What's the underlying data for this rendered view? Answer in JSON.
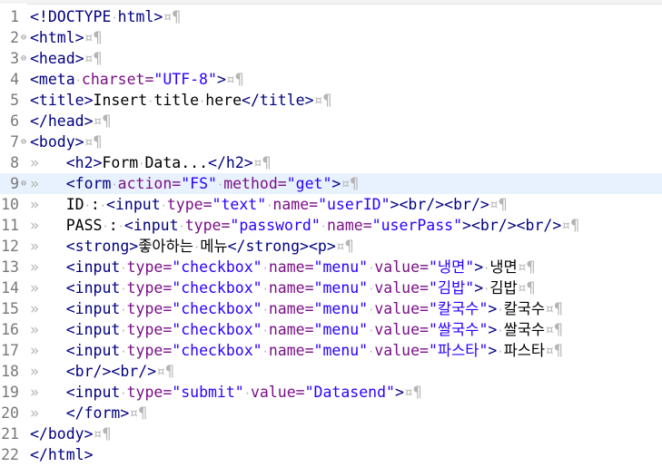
{
  "editor": {
    "lines": [
      {
        "n": "1",
        "fold": false,
        "indent": 0,
        "tokens": [
          [
            "tag",
            "<!DOCTYPE"
          ],
          [
            "ws",
            "·"
          ],
          [
            "tag",
            "html>"
          ]
        ]
      },
      {
        "n": "2",
        "fold": true,
        "indent": 0,
        "tokens": [
          [
            "tag",
            "<html>"
          ]
        ]
      },
      {
        "n": "3",
        "fold": true,
        "indent": 0,
        "tokens": [
          [
            "tag",
            "<head>"
          ]
        ]
      },
      {
        "n": "4",
        "fold": false,
        "indent": 0,
        "tokens": [
          [
            "tag",
            "<meta"
          ],
          [
            "ws",
            "·"
          ],
          [
            "attr",
            "charset="
          ],
          [
            "val",
            "\"UTF-8\""
          ],
          [
            "tag",
            ">"
          ]
        ]
      },
      {
        "n": "5",
        "fold": false,
        "indent": 0,
        "tokens": [
          [
            "tag",
            "<title>"
          ],
          [
            "txt",
            "Insert"
          ],
          [
            "ws",
            "·"
          ],
          [
            "txt",
            "title"
          ],
          [
            "ws",
            "·"
          ],
          [
            "txt",
            "here"
          ],
          [
            "tag",
            "</title>"
          ]
        ]
      },
      {
        "n": "6",
        "fold": false,
        "indent": 0,
        "tokens": [
          [
            "tag",
            "</head>"
          ]
        ]
      },
      {
        "n": "7",
        "fold": true,
        "indent": 0,
        "tokens": [
          [
            "tag",
            "<body>"
          ]
        ]
      },
      {
        "n": "8",
        "fold": false,
        "indent": 1,
        "tokens": [
          [
            "tag",
            "<h2>"
          ],
          [
            "txt",
            "Form"
          ],
          [
            "ws",
            "·"
          ],
          [
            "txt",
            "Data..."
          ],
          [
            "tag",
            "</h2>"
          ]
        ]
      },
      {
        "n": "9",
        "fold": true,
        "indent": 1,
        "current": true,
        "tokens": [
          [
            "tag",
            "<form"
          ],
          [
            "ws",
            "·"
          ],
          [
            "attr",
            "action="
          ],
          [
            "val",
            "\"FS\""
          ],
          [
            "ws",
            "·"
          ],
          [
            "attr",
            "method="
          ],
          [
            "val",
            "\"get\""
          ],
          [
            "tag",
            ">"
          ]
        ]
      },
      {
        "n": "10",
        "fold": false,
        "indent": 1,
        "tokens": [
          [
            "txt",
            "ID"
          ],
          [
            "ws",
            "·"
          ],
          [
            "txt",
            ":"
          ],
          [
            "ws",
            "·"
          ],
          [
            "tag",
            "<input"
          ],
          [
            "ws",
            "·"
          ],
          [
            "attr",
            "type="
          ],
          [
            "val",
            "\"text\""
          ],
          [
            "ws",
            "·"
          ],
          [
            "attr",
            "name="
          ],
          [
            "val",
            "\"userID\""
          ],
          [
            "tag",
            ">"
          ],
          [
            "tag",
            "<br/>"
          ],
          [
            "tag",
            "<br/>"
          ]
        ]
      },
      {
        "n": "11",
        "fold": false,
        "indent": 1,
        "tokens": [
          [
            "txt",
            "PASS"
          ],
          [
            "ws",
            "·"
          ],
          [
            "txt",
            ":"
          ],
          [
            "ws",
            "·"
          ],
          [
            "tag",
            "<input"
          ],
          [
            "ws",
            "·"
          ],
          [
            "attr",
            "type="
          ],
          [
            "val",
            "\"password\""
          ],
          [
            "ws",
            "·"
          ],
          [
            "attr",
            "name="
          ],
          [
            "val",
            "\"userPass\""
          ],
          [
            "tag",
            ">"
          ],
          [
            "tag",
            "<br/>"
          ],
          [
            "tag",
            "<br/>"
          ]
        ]
      },
      {
        "n": "12",
        "fold": false,
        "indent": 1,
        "tokens": [
          [
            "tag",
            "<strong>"
          ],
          [
            "txt",
            "좋아하는"
          ],
          [
            "ws",
            "·"
          ],
          [
            "txt",
            "메뉴"
          ],
          [
            "tag",
            "</strong>"
          ],
          [
            "tag",
            "<p>"
          ]
        ]
      },
      {
        "n": "13",
        "fold": false,
        "indent": 1,
        "tokens": [
          [
            "tag",
            "<input"
          ],
          [
            "ws",
            "·"
          ],
          [
            "attr",
            "type="
          ],
          [
            "val",
            "\"checkbox\""
          ],
          [
            "ws",
            "·"
          ],
          [
            "attr",
            "name="
          ],
          [
            "val",
            "\"menu\""
          ],
          [
            "ws",
            "·"
          ],
          [
            "attr",
            "value="
          ],
          [
            "val",
            "\"냉면\""
          ],
          [
            "tag",
            ">"
          ],
          [
            "ws",
            "·"
          ],
          [
            "txt",
            "냉면"
          ]
        ]
      },
      {
        "n": "14",
        "fold": false,
        "indent": 1,
        "tokens": [
          [
            "tag",
            "<input"
          ],
          [
            "ws",
            "·"
          ],
          [
            "attr",
            "type="
          ],
          [
            "val",
            "\"checkbox\""
          ],
          [
            "ws",
            "·"
          ],
          [
            "attr",
            "name="
          ],
          [
            "val",
            "\"menu\""
          ],
          [
            "ws",
            "·"
          ],
          [
            "attr",
            "value="
          ],
          [
            "val",
            "\"김밥\""
          ],
          [
            "tag",
            ">"
          ],
          [
            "ws",
            "·"
          ],
          [
            "txt",
            "김밥"
          ]
        ]
      },
      {
        "n": "15",
        "fold": false,
        "indent": 1,
        "tokens": [
          [
            "tag",
            "<input"
          ],
          [
            "ws",
            "·"
          ],
          [
            "attr",
            "type="
          ],
          [
            "val",
            "\"checkbox\""
          ],
          [
            "ws",
            "·"
          ],
          [
            "attr",
            "name="
          ],
          [
            "val",
            "\"menu\""
          ],
          [
            "ws",
            "·"
          ],
          [
            "attr",
            "value="
          ],
          [
            "val",
            "\"칼국수\""
          ],
          [
            "tag",
            ">"
          ],
          [
            "ws",
            "·"
          ],
          [
            "txt",
            "칼국수"
          ]
        ]
      },
      {
        "n": "16",
        "fold": false,
        "indent": 1,
        "tokens": [
          [
            "tag",
            "<input"
          ],
          [
            "ws",
            "·"
          ],
          [
            "attr",
            "type="
          ],
          [
            "val",
            "\"checkbox\""
          ],
          [
            "ws",
            "·"
          ],
          [
            "attr",
            "name="
          ],
          [
            "val",
            "\"menu\""
          ],
          [
            "ws",
            "·"
          ],
          [
            "attr",
            "value="
          ],
          [
            "val",
            "\"쌀국수\""
          ],
          [
            "tag",
            ">"
          ],
          [
            "ws",
            "·"
          ],
          [
            "txt",
            "쌀국수"
          ]
        ]
      },
      {
        "n": "17",
        "fold": false,
        "indent": 1,
        "tokens": [
          [
            "tag",
            "<input"
          ],
          [
            "ws",
            "·"
          ],
          [
            "attr",
            "type="
          ],
          [
            "val",
            "\"checkbox\""
          ],
          [
            "ws",
            "·"
          ],
          [
            "attr",
            "name="
          ],
          [
            "val",
            "\"menu\""
          ],
          [
            "ws",
            "·"
          ],
          [
            "attr",
            "value="
          ],
          [
            "val",
            "\"파스타\""
          ],
          [
            "tag",
            ">"
          ],
          [
            "ws",
            "·"
          ],
          [
            "txt",
            "파스타"
          ]
        ]
      },
      {
        "n": "18",
        "fold": false,
        "indent": 1,
        "tokens": [
          [
            "tag",
            "<br/>"
          ],
          [
            "tag",
            "<br/>"
          ]
        ]
      },
      {
        "n": "19",
        "fold": false,
        "indent": 1,
        "tokens": [
          [
            "tag",
            "<input"
          ],
          [
            "ws",
            "·"
          ],
          [
            "attr",
            "type="
          ],
          [
            "val",
            "\"submit\""
          ],
          [
            "ws",
            "·"
          ],
          [
            "attr",
            "value="
          ],
          [
            "val",
            "\"Datasend\""
          ],
          [
            "tag",
            ">"
          ]
        ]
      },
      {
        "n": "20",
        "fold": false,
        "indent": 1,
        "tokens": [
          [
            "tag",
            "</form>"
          ]
        ]
      },
      {
        "n": "21",
        "fold": false,
        "indent": 0,
        "tokens": [
          [
            "tag",
            "</body>"
          ]
        ]
      },
      {
        "n": "22",
        "fold": false,
        "indent": 0,
        "noNewline": true,
        "tokens": [
          [
            "tag",
            "</html>"
          ]
        ]
      }
    ],
    "markers": {
      "tab": "»",
      "line_end": "¤¶",
      "fold_collapse": "⊖"
    }
  }
}
